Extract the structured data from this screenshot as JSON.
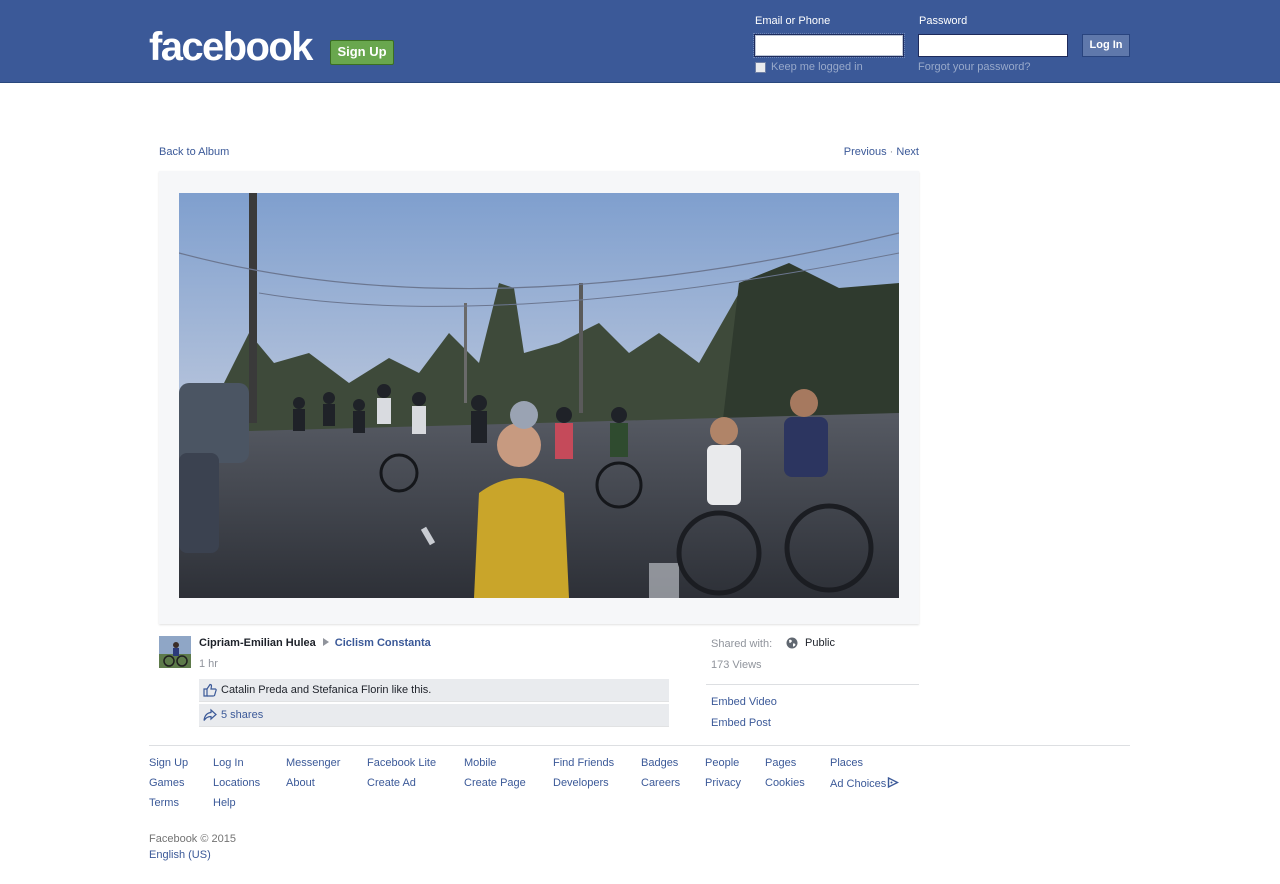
{
  "header": {
    "logo": "facebook",
    "signup_label": "Sign Up",
    "email_label": "Email or Phone",
    "email_value": "",
    "password_label": "Password",
    "password_value": "",
    "login_label": "Log In",
    "keep_logged_in": "Keep me logged in",
    "forgot_password": "Forgot your password?"
  },
  "nav": {
    "back_to_album": "Back to Album",
    "previous": "Previous",
    "separator": " · ",
    "next": "Next"
  },
  "post": {
    "author": "Cipriam-Emilian Hulea",
    "album": "Ciclism Constanta",
    "time": "1 hr",
    "likes_text": "Catalin Preda and Stefanica Florin like this.",
    "shares_text": "5 shares",
    "shared_with_label": "Shared with:",
    "privacy": "Public",
    "views": "173 Views",
    "embed_video": "Embed Video",
    "embed_post": "Embed Post"
  },
  "footer": {
    "links": [
      [
        "Sign Up",
        "Games",
        "Terms"
      ],
      [
        "Log In",
        "Locations",
        "Help"
      ],
      [
        "Messenger",
        "About"
      ],
      [
        "Facebook Lite",
        "Create Ad"
      ],
      [
        "Mobile",
        "Create Page"
      ],
      [
        "Find Friends",
        "Developers"
      ],
      [
        "Badges",
        "Careers"
      ],
      [
        "People",
        "Privacy"
      ],
      [
        "Pages",
        "Cookies"
      ],
      [
        "Places",
        "Ad Choices"
      ]
    ],
    "copyright": "Facebook © 2015",
    "language": "English (US)"
  },
  "colors": {
    "brand": "#3b5998",
    "signup_green": "#69a74e",
    "link": "#3b5998",
    "muted": "#90949c"
  }
}
